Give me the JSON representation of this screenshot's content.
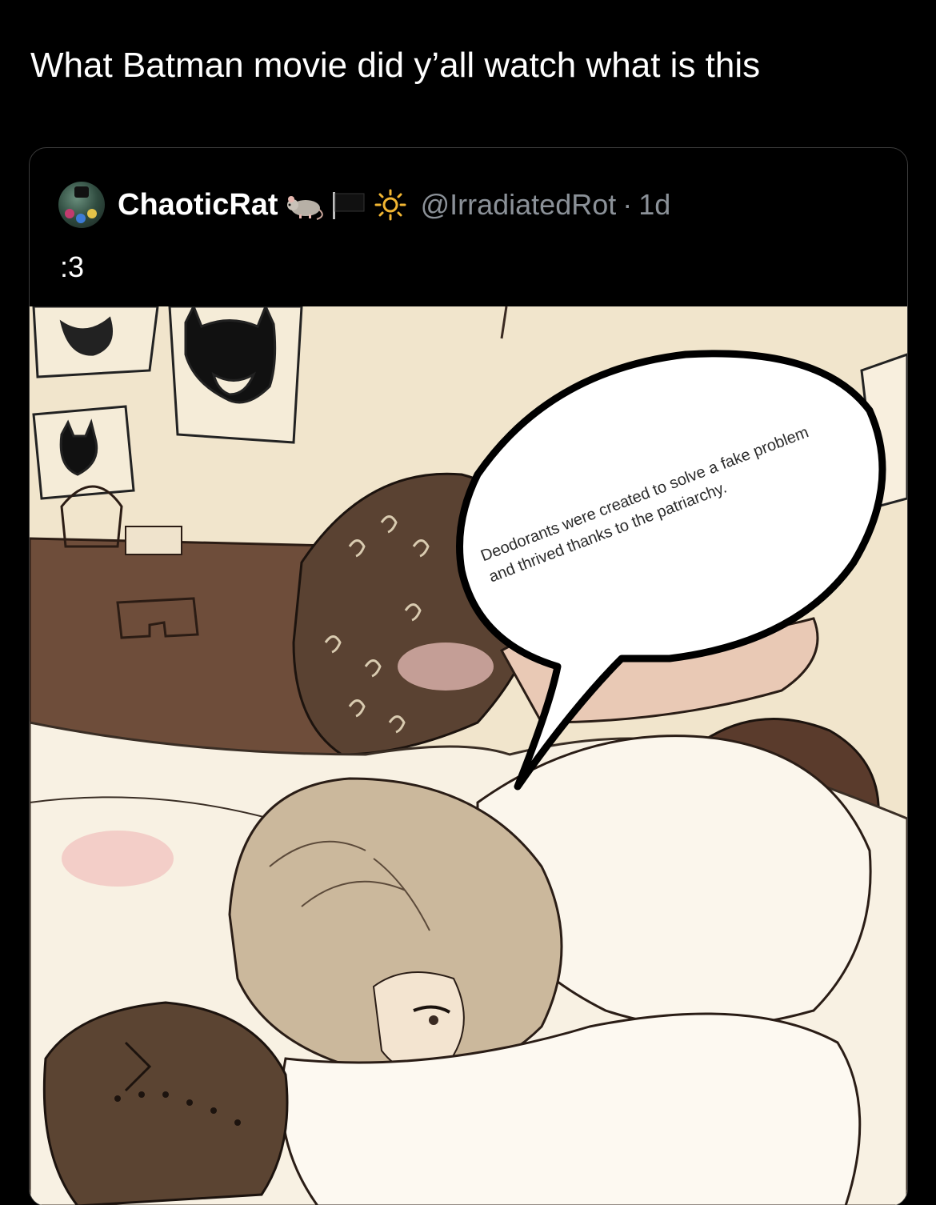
{
  "tweet": {
    "text": "What Batman movie did y’all watch what is this"
  },
  "quoted_tweet": {
    "display_name": "ChaoticRat",
    "name_emojis": [
      "rat-emoji",
      "black-flag-emoji",
      "sun-emoji"
    ],
    "handle": "@IrradiatedRot",
    "separator": "·",
    "time": "1d",
    "text": ":3",
    "media": {
      "speech_bubble_text": "Deodorants were created to solve a fake problem and thrived thanks to the patriarchy."
    }
  }
}
